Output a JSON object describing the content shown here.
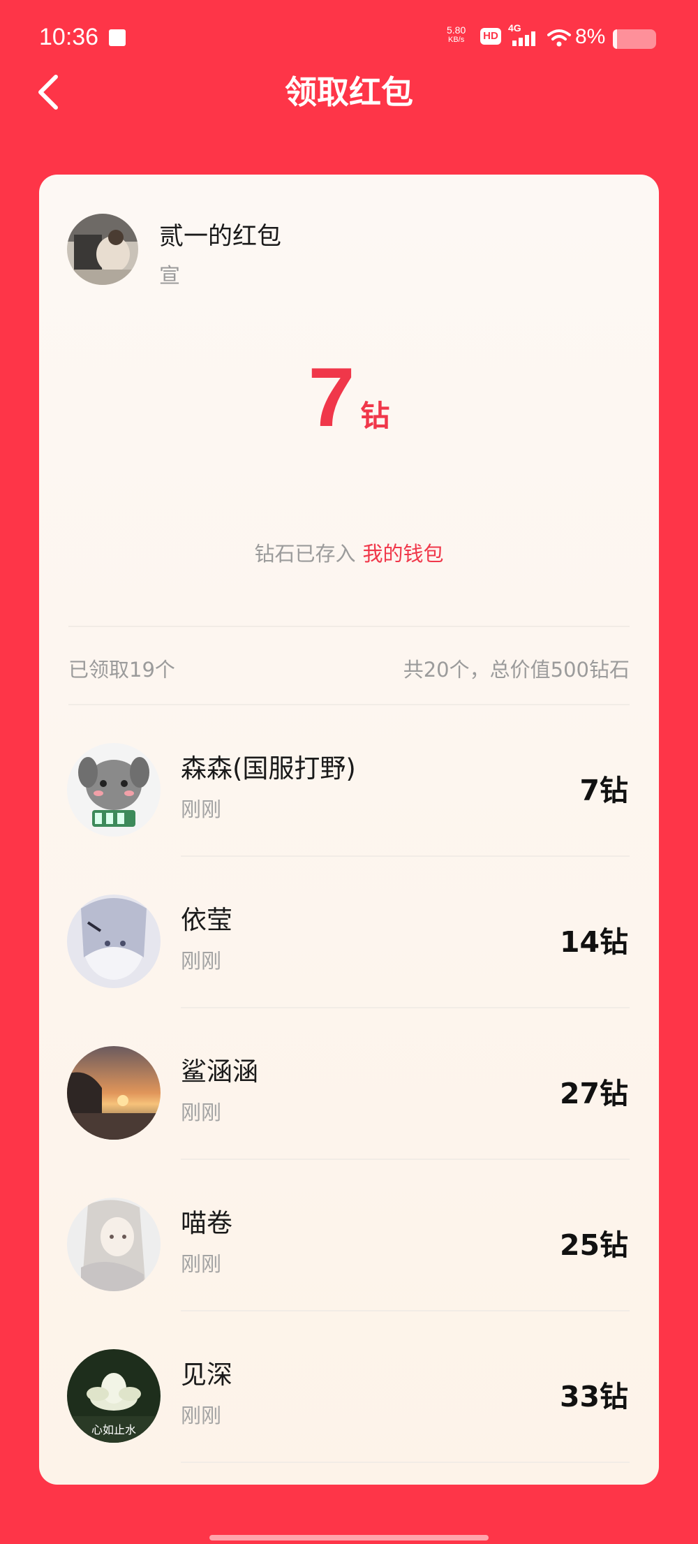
{
  "status_bar": {
    "time": "10:36",
    "net_speed_value": "5.80",
    "net_speed_unit": "KB/s",
    "hd": "HD",
    "network": "4G",
    "battery": "8%",
    "battery_level": 0.08
  },
  "header": {
    "title": "领取红包"
  },
  "sender": {
    "name": "贰一的红包",
    "subtitle": "宣"
  },
  "amount": {
    "value": "7",
    "unit": "钻"
  },
  "wallet": {
    "prefix": "钻石已存入",
    "link": "我的钱包"
  },
  "summary": {
    "claimed": "已领取19个",
    "total": "共20个，总价值500钻石"
  },
  "recipients": [
    {
      "name": "森森(国服打野)",
      "time": "刚刚",
      "amount": "7钻"
    },
    {
      "name": "依莹",
      "time": "刚刚",
      "amount": "14钻"
    },
    {
      "name": "鲨涵涵",
      "time": "刚刚",
      "amount": "27钻"
    },
    {
      "name": "喵卷",
      "time": "刚刚",
      "amount": "25钻"
    },
    {
      "name": "见深",
      "time": "刚刚",
      "amount": "33钻",
      "avatar_caption": "心如止水"
    }
  ],
  "colors": {
    "brand_red": "#fe3548",
    "amount_red": "#f0374a",
    "card_bg": "#fdf6ef"
  }
}
